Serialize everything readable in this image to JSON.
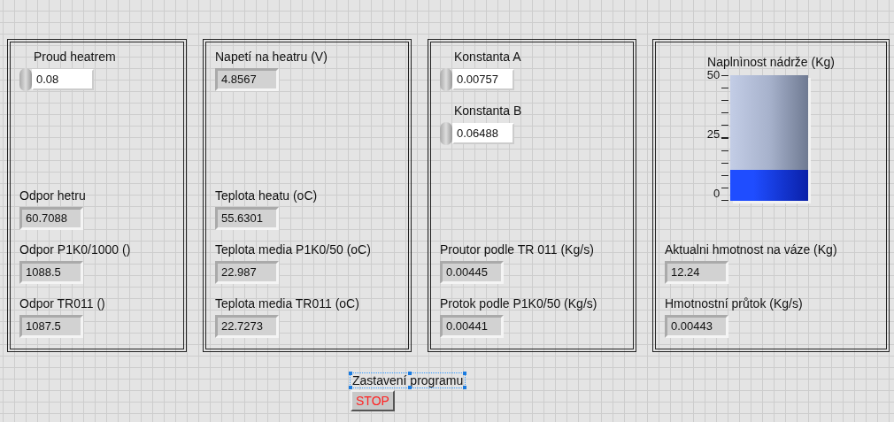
{
  "panels": [
    {
      "top": [
        {
          "kind": "control",
          "label": "Proud heatrem",
          "value": "0.08"
        }
      ],
      "bottom": [
        {
          "kind": "indicator",
          "label": "Odpor hetru",
          "value": "60.7088"
        },
        {
          "kind": "indicator",
          "label": "Odpor P1K0/1000 ()",
          "value": "1088.5"
        },
        {
          "kind": "indicator",
          "label": "Odpor TR011 ()",
          "value": "1087.5"
        }
      ]
    },
    {
      "top": [
        {
          "kind": "indicator",
          "label": "Napetí na heatru (V)",
          "value": "4.8567"
        }
      ],
      "bottom": [
        {
          "kind": "indicator",
          "label": "Teplota heatu (oC)",
          "value": "55.6301"
        },
        {
          "kind": "indicator",
          "label": "Teplota media P1K0/50 (oC)",
          "value": "22.987"
        },
        {
          "kind": "indicator",
          "label": "Teplota media TR011 (oC)",
          "value": "22.7273"
        }
      ]
    },
    {
      "top": [
        {
          "kind": "control",
          "label": "Konstanta A",
          "value": "0.00757"
        },
        {
          "kind": "control",
          "label": "Konstanta B",
          "value": "0.06488"
        }
      ],
      "bottom": [
        {
          "kind": "indicator",
          "label": "Proutor podle TR 011 (Kg/s)",
          "value": "0.00445"
        },
        {
          "kind": "indicator",
          "label": "Protok podle P1K0/50 (Kg/s)",
          "value": "0.00441"
        }
      ]
    },
    {
      "top": [
        {
          "kind": "tank",
          "label": "Naplnìnost nádrže (Kg)",
          "scale": [
            "50",
            "25",
            "0"
          ],
          "level": 0.2448
        }
      ],
      "bottom": [
        {
          "kind": "indicator",
          "label": "Aktualni hmotnost na váze (Kg)",
          "value": "12.24"
        },
        {
          "kind": "indicator",
          "label": "Hmotnostní průtok (Kg/s)",
          "value": "0.00443"
        }
      ]
    }
  ],
  "stop": {
    "label": "Zastavení programu",
    "label_selected": true,
    "button": "STOP"
  }
}
